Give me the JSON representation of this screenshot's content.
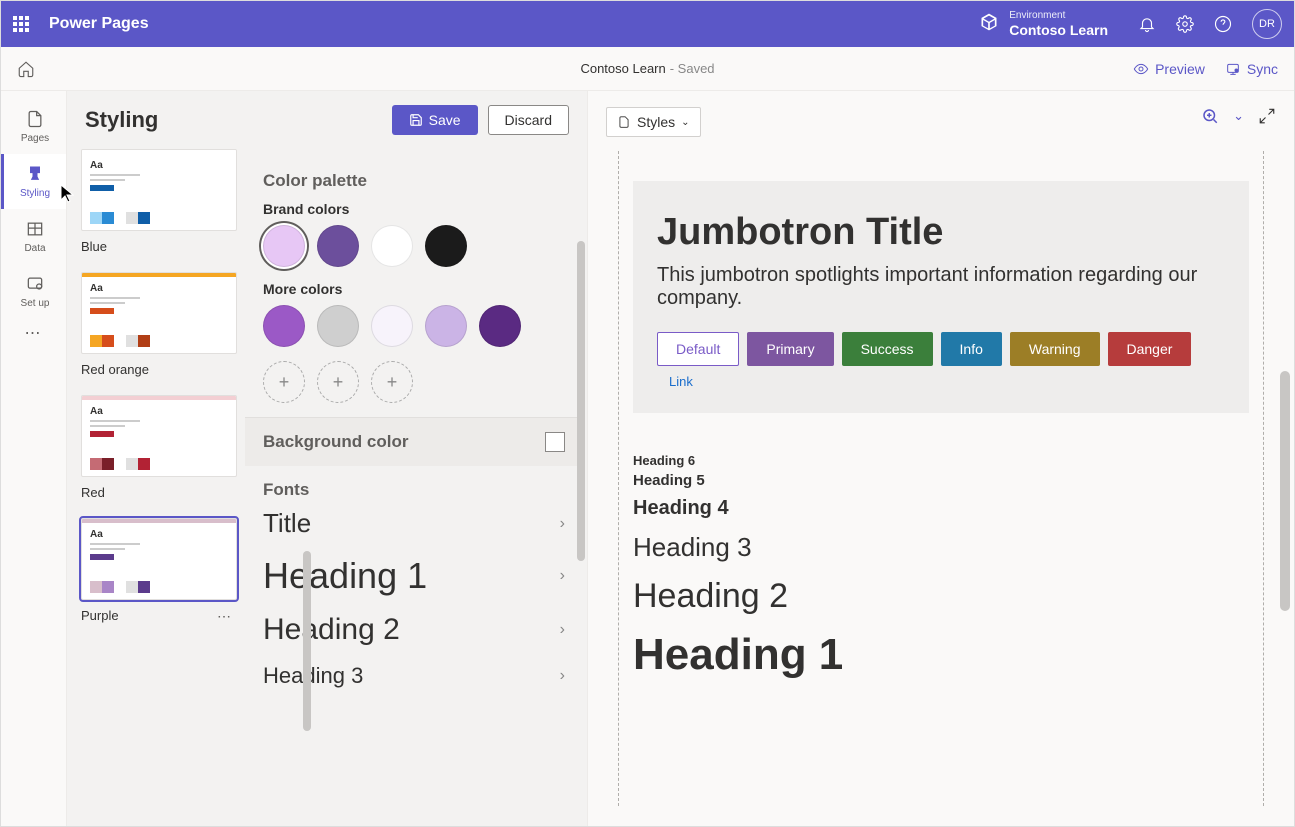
{
  "topbar": {
    "app_title": "Power Pages",
    "env_label": "Environment",
    "env_name": "Contoso Learn",
    "user_initials": "DR"
  },
  "cmdbar": {
    "doc_title": "Contoso Learn",
    "doc_status": " - Saved",
    "preview": "Preview",
    "sync": "Sync"
  },
  "rail": {
    "pages": "Pages",
    "styling": "Styling",
    "data": "Data",
    "setup": "Set up"
  },
  "panel": {
    "title": "Styling",
    "save": "Save",
    "discard": "Discard",
    "color_palette": "Color palette",
    "brand_colors": "Brand colors",
    "more_colors": "More colors",
    "background_color": "Background color",
    "fonts": "Fonts",
    "font_title": "Title",
    "font_h1": "Heading 1",
    "font_h2": "Heading 2",
    "font_h3": "Heading 3"
  },
  "themes": [
    {
      "name": "Blue",
      "strip": "#ffffff",
      "accent": "#0f5ea8",
      "swatches": [
        "#9dd6f7",
        "#2a8bd4",
        "#ffffff",
        "#e0e0e0",
        "#0f5ea8"
      ]
    },
    {
      "name": "Red orange",
      "strip": "#f5a623",
      "accent": "#d64d1b",
      "swatches": [
        "#f5a623",
        "#d64d1b",
        "#ffffff",
        "#e0e0e0",
        "#b13e15"
      ]
    },
    {
      "name": "Red",
      "strip": "#f3cfd3",
      "accent": "#b22234",
      "swatches": [
        "#c56b74",
        "#7a1f29",
        "#ffffff",
        "#e0e0e0",
        "#b22234"
      ]
    },
    {
      "name": "Purple",
      "strip": "#d8becb",
      "accent": "#5b3b8c",
      "swatches": [
        "#d8becb",
        "#a985c7",
        "#ffffff",
        "#e0e0e0",
        "#5b3b8c"
      ],
      "selected": true
    }
  ],
  "brand_swatches": [
    {
      "color": "#e7c7f5",
      "selected": true
    },
    {
      "color": "#6c4f9c"
    },
    {
      "color": "#ffffff"
    },
    {
      "color": "#1b1b1b"
    }
  ],
  "more_swatches": [
    {
      "color": "#9b59c6"
    },
    {
      "color": "#cfcfcf"
    },
    {
      "color": "#f7f3fb"
    },
    {
      "color": "#cbb4e6"
    },
    {
      "color": "#5a2a82"
    }
  ],
  "preview": {
    "dropdown": "Styles",
    "jumbo_title": "Jumbotron Title",
    "jumbo_text": "This jumbotron spotlights important information regarding our company.",
    "btn_default": "Default",
    "btn_primary": "Primary",
    "btn_success": "Success",
    "btn_info": "Info",
    "btn_warning": "Warning",
    "btn_danger": "Danger",
    "link": "Link",
    "h6": "Heading 6",
    "h5": "Heading 5",
    "h4": "Heading 4",
    "h3": "Heading 3",
    "h2": "Heading 2",
    "h1": "Heading 1"
  }
}
